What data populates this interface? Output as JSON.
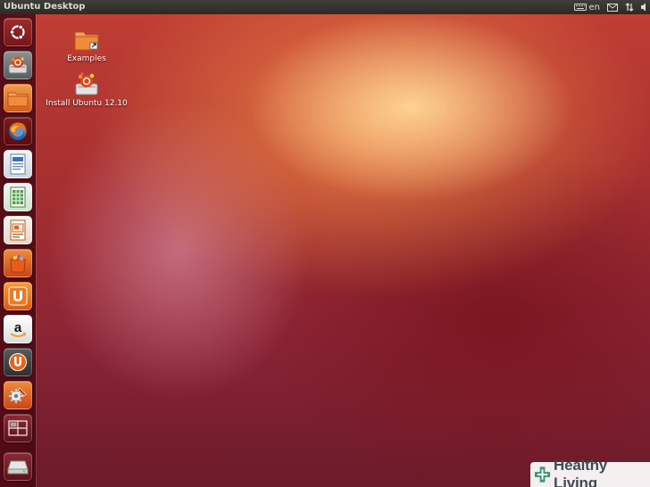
{
  "top_panel": {
    "title": "Ubuntu Desktop",
    "keyboard_layout": "en"
  },
  "launcher": {
    "items": [
      {
        "name": "dash-home",
        "icon": "ubuntu-logo-icon"
      },
      {
        "name": "install-ubuntu",
        "icon": "installer-icon"
      },
      {
        "name": "home-folder",
        "icon": "folder-icon"
      },
      {
        "name": "firefox",
        "icon": "firefox-icon"
      },
      {
        "name": "libreoffice-writer",
        "icon": "writer-icon"
      },
      {
        "name": "libreoffice-calc",
        "icon": "calc-icon"
      },
      {
        "name": "libreoffice-impress",
        "icon": "impress-icon"
      },
      {
        "name": "software-center",
        "icon": "shopping-bag-icon"
      },
      {
        "name": "ubuntu-one",
        "icon": "ubuntu-one-icon"
      },
      {
        "name": "amazon",
        "icon": "amazon-icon"
      },
      {
        "name": "ubuntu-one-music",
        "icon": "ubuntu-one-music-icon"
      },
      {
        "name": "system-settings",
        "icon": "settings-icon"
      },
      {
        "name": "workspace-switcher",
        "icon": "workspaces-icon"
      },
      {
        "name": "devices",
        "icon": "drive-icon"
      }
    ]
  },
  "desktop": {
    "icons": [
      {
        "label": "Examples",
        "icon": "folder-link-icon"
      },
      {
        "label": "Install Ubuntu 12.10",
        "icon": "installer-icon"
      }
    ]
  },
  "watermark": {
    "text": "Healthy Living",
    "accent": "#2f9e6f"
  },
  "colors": {
    "panel": "#2b2a27",
    "launcher": "#4a0a14",
    "folder": "#e8803a"
  }
}
